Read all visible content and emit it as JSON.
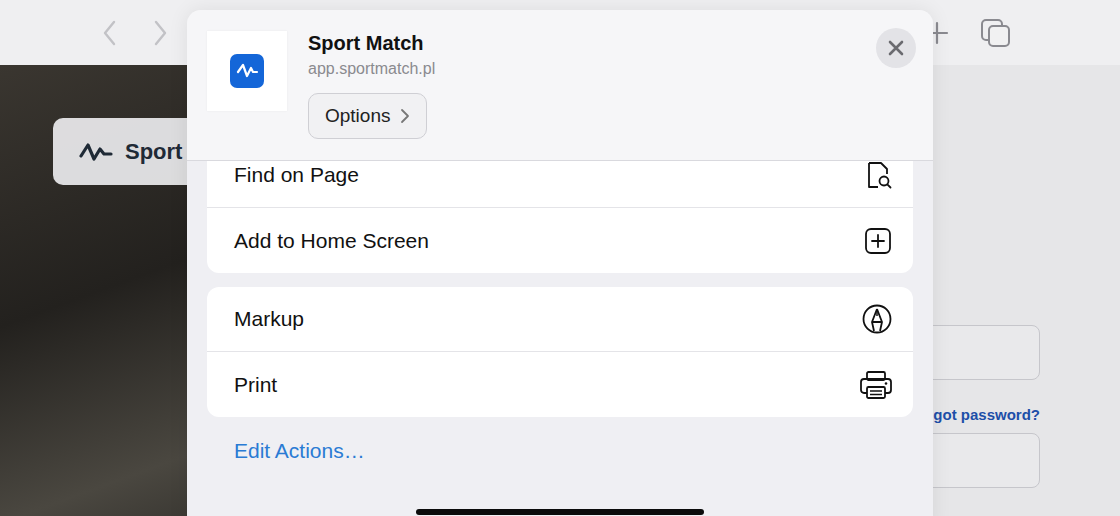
{
  "toolbar": {
    "back": {
      "disabled": true
    },
    "forward": {
      "disabled": true
    }
  },
  "page": {
    "brand": "Sport",
    "link": "got password?",
    "fields": [
      {
        "value": ""
      },
      {
        "value": ""
      }
    ]
  },
  "sheet": {
    "title": "Sport Match",
    "subtitle": "app.sportmatch.pl",
    "options_button": "Options",
    "groups": [
      [
        {
          "label": "Find on Page",
          "kind": "find"
        },
        {
          "label": "Add to Home Screen",
          "kind": "add"
        }
      ],
      [
        {
          "label": "Markup",
          "kind": "markup"
        },
        {
          "label": "Print",
          "kind": "print"
        }
      ]
    ],
    "edit_actions": "Edit Actions…"
  }
}
